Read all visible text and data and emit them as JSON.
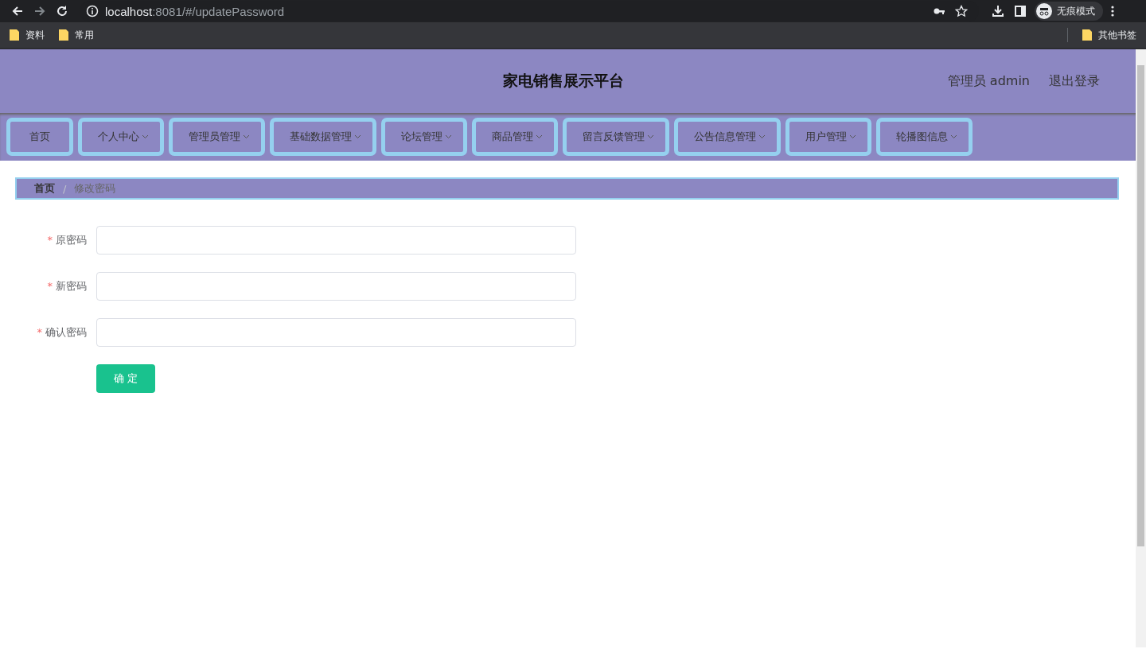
{
  "browser": {
    "url_host": "localhost",
    "url_rest": ":8081/#/updatePassword",
    "profile": "无痕模式",
    "bookmarks": [
      {
        "label": "资料"
      },
      {
        "label": "常用"
      }
    ],
    "other_bookmarks": "其他书签"
  },
  "header": {
    "title": "家电销售展示平台",
    "user": "管理员 admin",
    "logout": "退出登录"
  },
  "nav": [
    {
      "label": "首页",
      "dropdown": false
    },
    {
      "label": "个人中心",
      "dropdown": true
    },
    {
      "label": "管理员管理",
      "dropdown": true
    },
    {
      "label": "基础数据管理",
      "dropdown": true
    },
    {
      "label": "论坛管理",
      "dropdown": true
    },
    {
      "label": "商品管理",
      "dropdown": true
    },
    {
      "label": "留言反馈管理",
      "dropdown": true
    },
    {
      "label": "公告信息管理",
      "dropdown": true
    },
    {
      "label": "用户管理",
      "dropdown": true
    },
    {
      "label": "轮播图信息",
      "dropdown": true
    }
  ],
  "breadcrumb": {
    "separator": "/",
    "items": [
      {
        "label": "首页",
        "current": false
      },
      {
        "label": "修改密码",
        "current": true
      }
    ]
  },
  "form": {
    "fields": [
      {
        "label": "原密码",
        "required_mark": "*"
      },
      {
        "label": "新密码",
        "required_mark": "*"
      },
      {
        "label": "确认密码",
        "required_mark": "*"
      }
    ],
    "submit": "确 定"
  }
}
